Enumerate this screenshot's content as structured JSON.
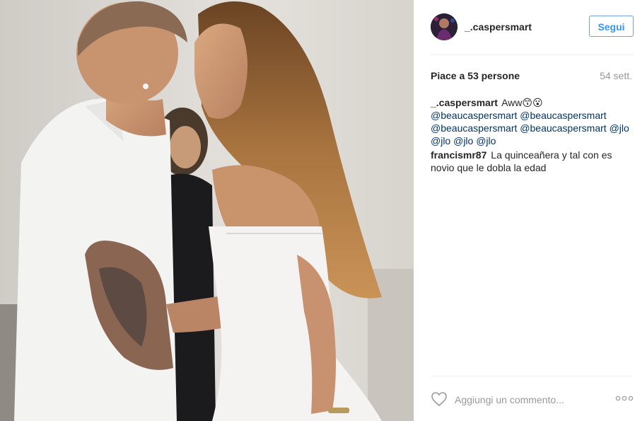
{
  "post": {
    "username": "_.caspersmart",
    "follow_label": "Segui",
    "likes_text": "Piace a 53 persone",
    "age_text": "54 sett."
  },
  "comments": [
    {
      "user": "_.caspersmart",
      "text": "Aww😙😮",
      "mentions": [
        "@beaucaspersmart",
        "@beaucaspersmart",
        "@beaucaspersmart",
        "@beaucaspersmart",
        "@jlo",
        "@jlo",
        "@jlo",
        "@jlo"
      ]
    },
    {
      "user": "francismr87",
      "text": "La quinceañera y tal con es novio que le dobla la edad"
    }
  ],
  "footer": {
    "comment_placeholder": "Aggiungi un commento...",
    "heart_icon": "heart-outline-icon",
    "more_icon": "more-options-icon"
  },
  "colors": {
    "follow_border": "#70a1d7",
    "follow_text": "#3897f0",
    "mention": "#003569",
    "muted": "#999999"
  }
}
